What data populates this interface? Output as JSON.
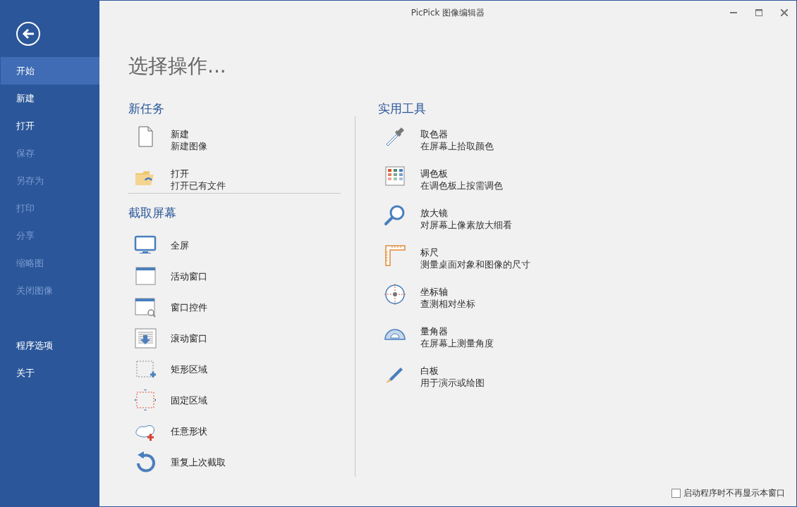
{
  "window": {
    "title": "PicPick 图像编辑器"
  },
  "sidebar": {
    "items": [
      {
        "label": "开始",
        "selected": true,
        "disabled": false
      },
      {
        "label": "新建",
        "selected": false,
        "disabled": false
      },
      {
        "label": "打开",
        "selected": false,
        "disabled": false
      },
      {
        "label": "保存",
        "selected": false,
        "disabled": true
      },
      {
        "label": "另存为",
        "selected": false,
        "disabled": true
      },
      {
        "label": "打印",
        "selected": false,
        "disabled": true
      },
      {
        "label": "分享",
        "selected": false,
        "disabled": true
      },
      {
        "label": "缩略图",
        "selected": false,
        "disabled": true
      },
      {
        "label": "关闭图像",
        "selected": false,
        "disabled": true
      }
    ],
    "footer_items": [
      {
        "label": "程序选项",
        "selected": false,
        "disabled": false
      },
      {
        "label": "关于",
        "selected": false,
        "disabled": false
      }
    ]
  },
  "page_title": "选择操作...",
  "new_task": {
    "heading": "新任务",
    "items": [
      {
        "title": "新建",
        "subtitle": "新建图像"
      },
      {
        "title": "打开",
        "subtitle": "打开已有文件"
      }
    ]
  },
  "capture": {
    "heading": "截取屏幕",
    "items": [
      {
        "label": "全屏"
      },
      {
        "label": "活动窗口"
      },
      {
        "label": "窗口控件"
      },
      {
        "label": "滚动窗口"
      },
      {
        "label": "矩形区域"
      },
      {
        "label": "固定区域"
      },
      {
        "label": "任意形状"
      },
      {
        "label": "重复上次截取"
      }
    ]
  },
  "tools": {
    "heading": "实用工具",
    "items": [
      {
        "title": "取色器",
        "subtitle": "在屏幕上拾取颜色"
      },
      {
        "title": "调色板",
        "subtitle": "在调色板上按需调色"
      },
      {
        "title": "放大镜",
        "subtitle": "对屏幕上像素放大细看"
      },
      {
        "title": "标尺",
        "subtitle": "测量桌面对象和图像的尺寸"
      },
      {
        "title": "坐标轴",
        "subtitle": "查测相对坐标"
      },
      {
        "title": "量角器",
        "subtitle": "在屏幕上测量角度"
      },
      {
        "title": "白板",
        "subtitle": "用于演示或绘图"
      }
    ]
  },
  "startup_checkbox": {
    "label": "启动程序时不再显示本窗口",
    "checked": false
  }
}
